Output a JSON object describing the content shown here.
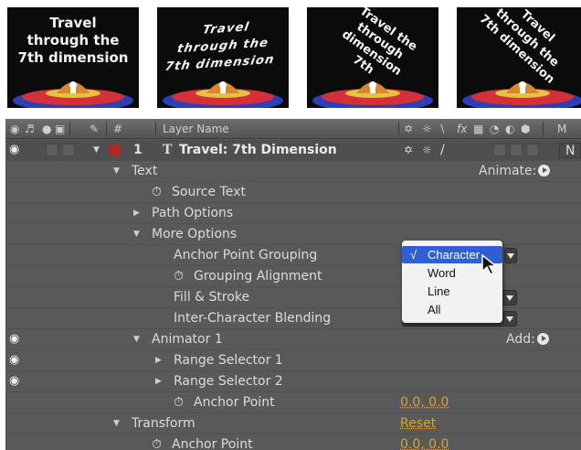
{
  "thumbnails": [
    {
      "text": "Travel\nthrough the\n7th dimension",
      "style": "plain"
    },
    {
      "text": "Travel\nthrough the\n7th dimension",
      "style": "wavy"
    },
    {
      "text": "Travel the\nthrough\ndimension\n7th",
      "style": "diag"
    },
    {
      "text": "Travel\nthrough the\n7th dimension",
      "style": "diag2"
    }
  ],
  "header": {
    "hash": "#",
    "layer_name": "Layer Name",
    "m": "M"
  },
  "layer": {
    "number": "1",
    "type_icon": "T",
    "name": "Travel: 7th Dimension",
    "label_color": "#b5262b",
    "right_cut": "N"
  },
  "rows": {
    "text": "Text",
    "animate_label": "Animate:",
    "source_text": "Source Text",
    "path_options": "Path Options",
    "more_options": "More Options",
    "anchor_point_grouping": "Anchor Point Grouping",
    "grouping_alignment": "Grouping Alignment",
    "fill_stroke": "Fill & Stroke",
    "inter_character_blending": "Inter-Character Blending",
    "animator_1": "Animator 1",
    "add_label": "Add:",
    "range_selector_1": "Range Selector 1",
    "range_selector_2": "Range Selector 2",
    "anchor_point": "Anchor Point",
    "anchor_point_value": "0.0, 0.0",
    "transform": "Transform",
    "reset_label": "Reset",
    "transform_anchor_point": "Anchor Point",
    "transform_anchor_value": "0.0, 0.0"
  },
  "dropdown_menu": {
    "items": [
      "Character",
      "Word",
      "Line",
      "All"
    ],
    "selected": "Character",
    "check": "√"
  },
  "colors": {
    "panel_bg": "#595959",
    "value_orange": "#d9a32e",
    "menu_highlight": "#2f5fd1"
  },
  "icons": [
    "eye-icon",
    "audio-icon",
    "solo-icon",
    "lock-icon",
    "label-tag-icon",
    "stopwatch-icon",
    "shy-icon",
    "collapse-icon",
    "quality-icon",
    "fx-icon",
    "motion-blur-icon",
    "adjustment-icon",
    "3d-icon",
    "animate-play-icon"
  ]
}
